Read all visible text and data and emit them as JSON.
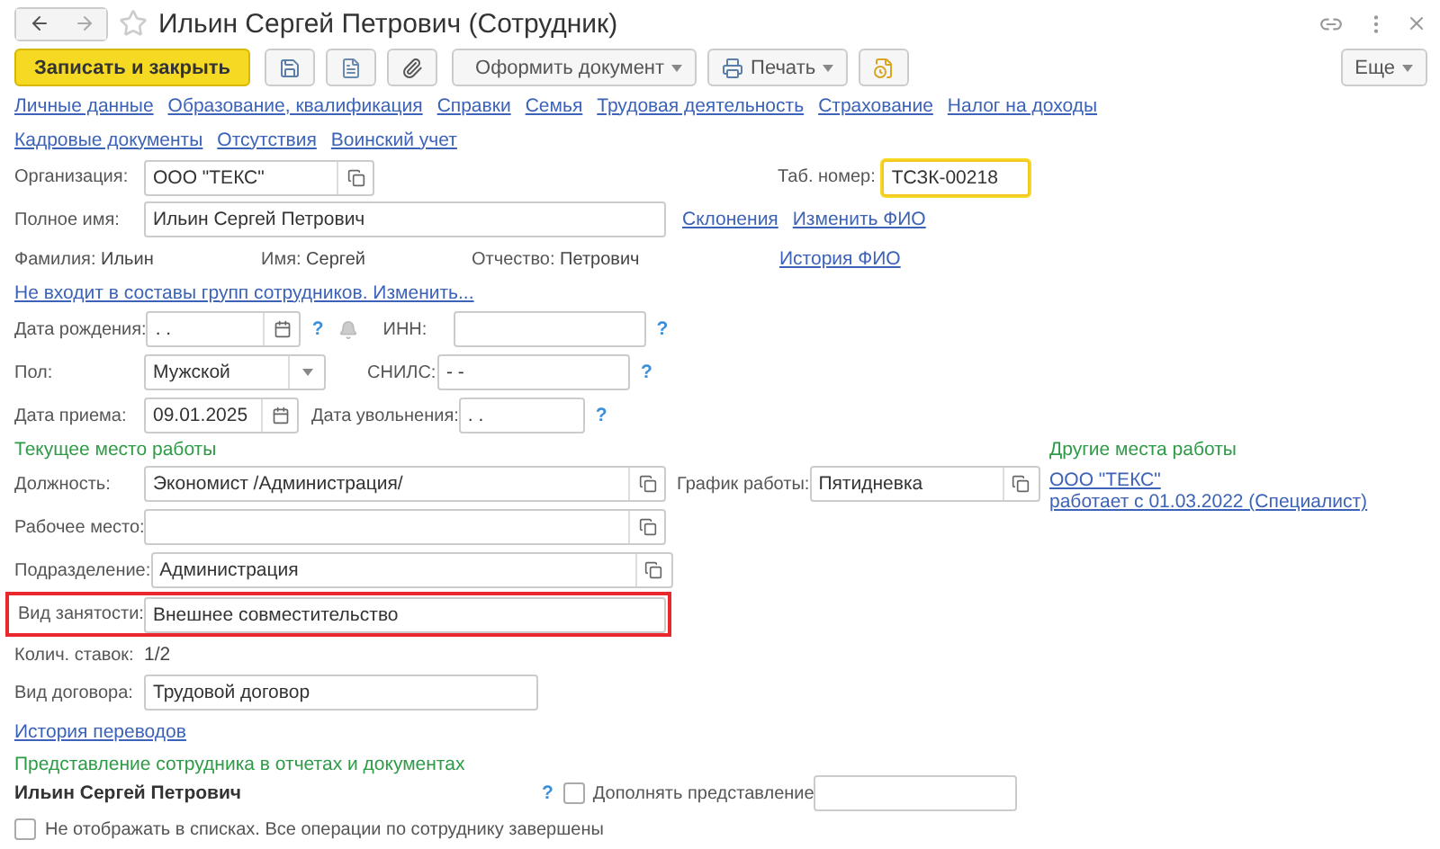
{
  "window": {
    "title": "Ильин Сергей Петрович (Сотрудник)",
    "favorite": false
  },
  "toolbar": {
    "save_close": "Записать и закрыть",
    "create_document": "Оформить документ",
    "print": "Печать",
    "more": "Еще"
  },
  "link_rows": [
    {
      "links": [
        "Личные данные",
        "Образование, квалификация",
        "Справки",
        "Семья",
        "Трудовая деятельность",
        "Страхование",
        "Налог на доходы"
      ]
    },
    {
      "links": [
        "Кадровые документы",
        "Отсутствия",
        "Воинский учет"
      ]
    }
  ],
  "organization": {
    "label": "Организация:",
    "value": "ООО \"ТЕКС\""
  },
  "tab_number": {
    "label": "Таб. номер:",
    "value": "ТСЗК-00218",
    "focused": true
  },
  "full_name": {
    "label": "Полное имя:",
    "value": "Ильин Сергей Петрович"
  },
  "name_links": [
    "Склонения",
    "Изменить ФИО"
  ],
  "name_parts": [
    {
      "label": "Фамилия:",
      "value": "Ильин"
    },
    {
      "label": "Имя:",
      "value": "Сергей"
    },
    {
      "label": "Отчество:",
      "value": "Петрович"
    }
  ],
  "fio_history": "История ФИО",
  "groups_link": "Не входит в составы групп сотрудников. Изменить...",
  "birth_date": {
    "label": "Дата рождения:",
    "value": ". .",
    "help": "?"
  },
  "inn": {
    "label": "ИНН:",
    "help": "?"
  },
  "gender": {
    "label": "Пол:",
    "value": "Мужской"
  },
  "snils": {
    "label": "СНИЛС:",
    "value": "- -",
    "help": "?"
  },
  "hire_date": {
    "label": "Дата приема:",
    "value": "09.01.2025"
  },
  "dismissal_date": {
    "label": "Дата увольнения:",
    "value": ". .",
    "help": "?"
  },
  "current_job": {
    "title": "Текущее место работы",
    "position": {
      "label": "Должность:",
      "value": "Экономист /Администрация/"
    },
    "schedule": {
      "label": "График работы:",
      "value": "Пятидневка"
    },
    "workplace": {
      "label": "Рабочее место:"
    },
    "department": {
      "label": "Подразделение:",
      "value": "Администрация"
    },
    "employment_type": {
      "label": "Вид занятости:",
      "value": "Внешнее совместительство",
      "highlighted": true
    },
    "rate": {
      "label": "Колич. ставок:",
      "value": "1/2"
    },
    "contract": {
      "label": "Вид договора:",
      "value": "Трудовой договор"
    }
  },
  "other_jobs": {
    "title": "Другие места работы",
    "lines": [
      "ООО \"ТЕКС\"",
      "работает с 01.03.2022 (Специалист)"
    ]
  },
  "transfer_history": "История переводов",
  "representation": {
    "title": "Представление сотрудника в отчетах и документах",
    "name": "Ильин Сергей Петрович",
    "help": "?",
    "supplement": {
      "label": "Дополнять представление",
      "checked": false
    }
  },
  "hide_in_lists": {
    "label": "Не отображать в списках. Все операции по сотруднику завершены",
    "checked": false
  }
}
